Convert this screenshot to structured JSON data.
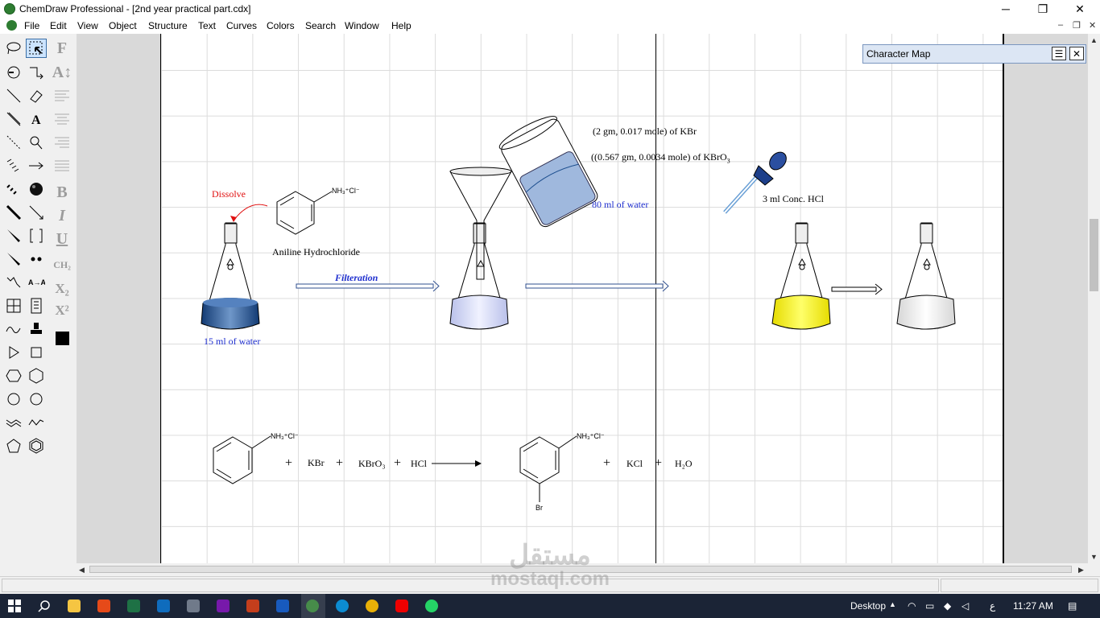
{
  "window": {
    "title": "ChemDraw Professional - [2nd year practical part.cdx]",
    "minimize_glyph": "─",
    "restore_glyph": "❐",
    "close_glyph": "✕"
  },
  "menu": {
    "items": [
      "File",
      "Edit",
      "View",
      "Object",
      "Structure",
      "Text",
      "Curves",
      "Colors",
      "Search",
      "Window",
      "Help"
    ],
    "mdi_minimize": "–",
    "mdi_restore": "❐",
    "mdi_close": "✕"
  },
  "toolbar": {
    "icons": [
      "lasso-icon",
      "marquee-select-icon",
      "rotate-icon",
      "structure-perspective-icon",
      "bond-icon",
      "eraser-icon",
      "wedge-bond-icon",
      "text-tool-icon",
      "dashed-bond-icon",
      "orbital-icon",
      "hashed-bond-icon",
      "arrow-icon",
      "bold-dashed-icon",
      "sphere-icon",
      "bold-bond-icon",
      "wedged-bond-icon",
      "bold-wedge-icon",
      "bracket-icon",
      "hollow-wedge-icon",
      "charge-dots-icon",
      "chain-icon",
      "mapping-icon",
      "table-icon",
      "template-icon",
      "curve-icon",
      "stamp-icon",
      "play-icon",
      "rectangle-icon",
      "cyclopentane-icon",
      "cyclohexane-icon",
      "cyclopentane-2-icon",
      "cyclohexane-2-icon",
      "cycloheptane-icon",
      "cyclooctane-icon",
      "pentagon-icon",
      "benzene-icon"
    ],
    "style_glyphs": [
      "F",
      "A↕",
      "B",
      "I",
      "U",
      "CH₂",
      "X₂",
      "X²"
    ],
    "selected_color": "#000000"
  },
  "document": {
    "labels": {
      "dissolve": "Dissolve",
      "aniline_hcl": "Aniline Hydrochloride",
      "water_15": "15 ml of water",
      "filteration": "Filteration",
      "kbr_amount": "(2 gm, 0.017 mole) of KBr",
      "kbro3_amount": "((0.567 gm, 0.0034 mole) of KBrO",
      "kbro3_sub": "3",
      "water_80": "80 ml of water",
      "hcl_conc": "3 ml Conc. HCl",
      "nh3cl_1": "NH₃⁺Cl⁻",
      "nh3cl_2": "NH₃⁺Cl⁻",
      "nh3cl_3": "NH₃⁺Cl⁻",
      "plus1": "+",
      "kbr": "KBr",
      "plus2": "+",
      "kbro3": "KBrO₃",
      "plus3": "+",
      "hcl": "HCl",
      "br": "Br",
      "plus4": "+",
      "kcl": "KCl",
      "plus5": "+",
      "h2o": "H₂O"
    },
    "colors": {
      "blue_solution": "#1d4f8f",
      "clear_solution": "#d9ddf5",
      "yellow_solution": "#f2f000",
      "label_blue": "#1f2fcf",
      "label_red": "#e01010"
    }
  },
  "char_map": {
    "title": "Character Map",
    "menu_glyph": "☰",
    "close_glyph": "✕"
  },
  "taskbar": {
    "icons": [
      "start-icon",
      "search-icon",
      "file-explorer-icon",
      "office-icon",
      "excel-icon",
      "outlook-icon",
      "calculator-icon",
      "onenote-icon",
      "powerpoint-icon",
      "word-icon",
      "chemdraw-icon",
      "edge-icon",
      "chrome-icon",
      "youtube-icon",
      "whatsapp-icon"
    ],
    "desktop": "Desktop",
    "language": "ع",
    "time": "11:27 AM"
  },
  "watermark": {
    "arabic": "مستقل",
    "latin": "mostaql.com"
  }
}
